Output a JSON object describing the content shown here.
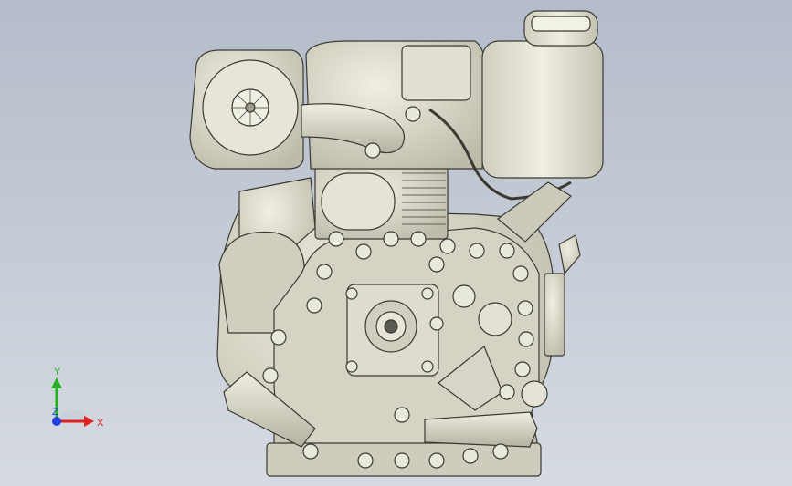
{
  "viewport": {
    "background_top": "#b4bcca",
    "background_bottom": "#d6dbe2",
    "model": {
      "description_icon": "engine-model",
      "fill_color": "#d8d7c7",
      "edge_color": "#3a3a33"
    }
  },
  "triad": {
    "x_label": "X",
    "y_label": "Y",
    "z_label": "Z",
    "x_color": "#e02020",
    "y_color": "#20b020",
    "z_color": "#2040e0"
  }
}
